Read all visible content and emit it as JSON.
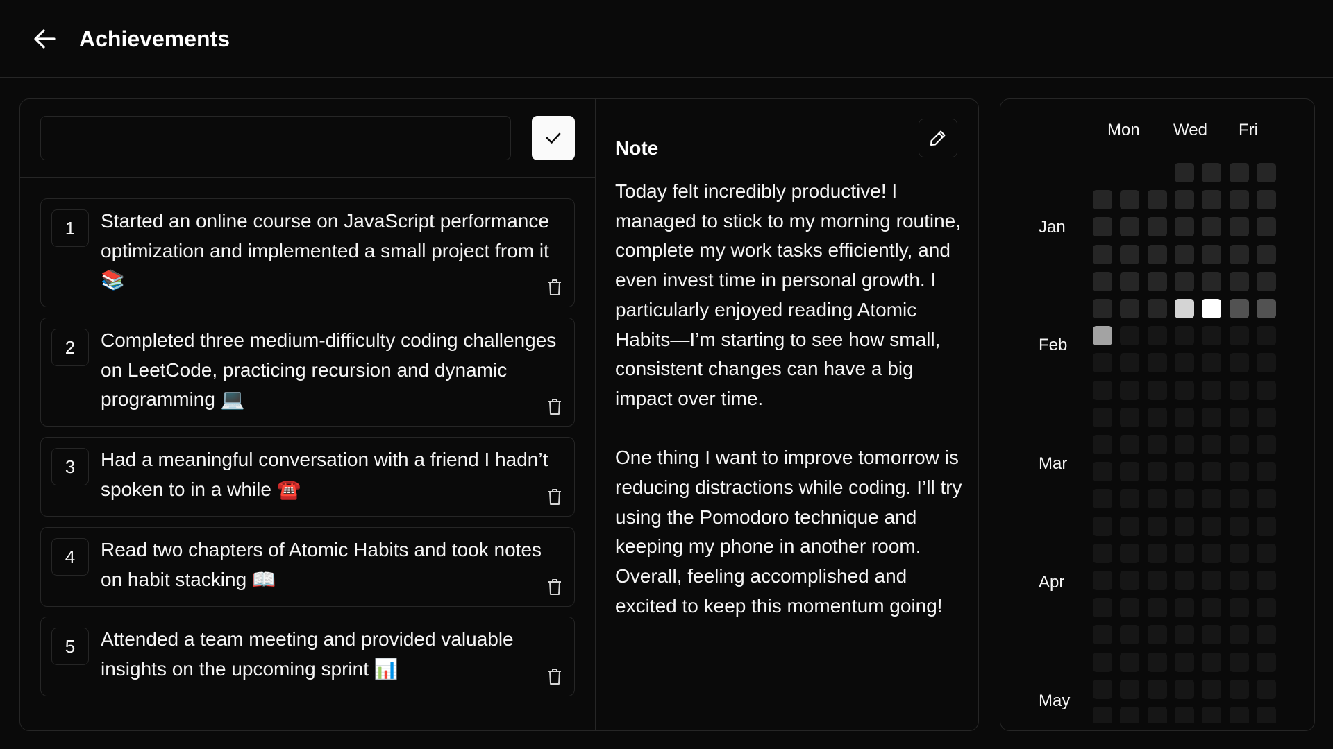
{
  "header": {
    "title": "Achievements",
    "back_icon": "arrow-left-icon"
  },
  "entry": {
    "input_value": "",
    "input_placeholder": "",
    "confirm_icon": "check-icon"
  },
  "achievements": [
    {
      "num": "1",
      "text": "Started an online course on JavaScript performance optimization and implemented a small project from it 📚"
    },
    {
      "num": "2",
      "text": "Completed three medium-difficulty coding challenges on LeetCode, practicing recursion and dynamic programming 💻"
    },
    {
      "num": "3",
      "text": "Had a meaningful conversation with a friend I hadn’t spoken to in a while ☎️"
    },
    {
      "num": "4",
      "text": "Read two chapters of Atomic Habits and took notes on habit stacking 📖"
    },
    {
      "num": "5",
      "text": "Attended a team meeting and provided valuable insights on the upcoming sprint 📊"
    }
  ],
  "note": {
    "title": "Note",
    "edit_icon": "pencil-icon",
    "paragraphs": [
      "Today felt incredibly productive! I managed to stick to my morning routine, complete my work tasks efficiently, and even invest time in personal growth. I particularly enjoyed reading Atomic Habits—I’m starting to see how small, consistent changes can have a big impact over time.",
      "One thing I want to improve tomorrow is reducing distractions while coding. I’ll try using the Pomodoro technique and keeping my phone in another room. Overall, feeling accomplished and excited to keep this momentum going!"
    ]
  },
  "heatmap": {
    "day_labels": [
      "Mon",
      "Wed",
      "Fri"
    ],
    "month_labels": [
      "Jan",
      "Feb",
      "Mar",
      "Apr",
      "May"
    ],
    "colors": {
      "past": "#262626",
      "future": "#161616",
      "level1": "#525252",
      "level3": "#a3a3a3",
      "level4": "#d4d4d4",
      "level5": "#ffffff"
    },
    "week_rows": 21,
    "first_row_start_col": 3,
    "today": {
      "week": 6,
      "day": 0
    },
    "active": [
      {
        "week": 5,
        "day": 3,
        "level": "level4"
      },
      {
        "week": 5,
        "day": 4,
        "level": "level5"
      },
      {
        "week": 5,
        "day": 5,
        "level": "level1"
      },
      {
        "week": 5,
        "day": 6,
        "level": "level1"
      },
      {
        "week": 6,
        "day": 0,
        "level": "level3"
      }
    ]
  }
}
